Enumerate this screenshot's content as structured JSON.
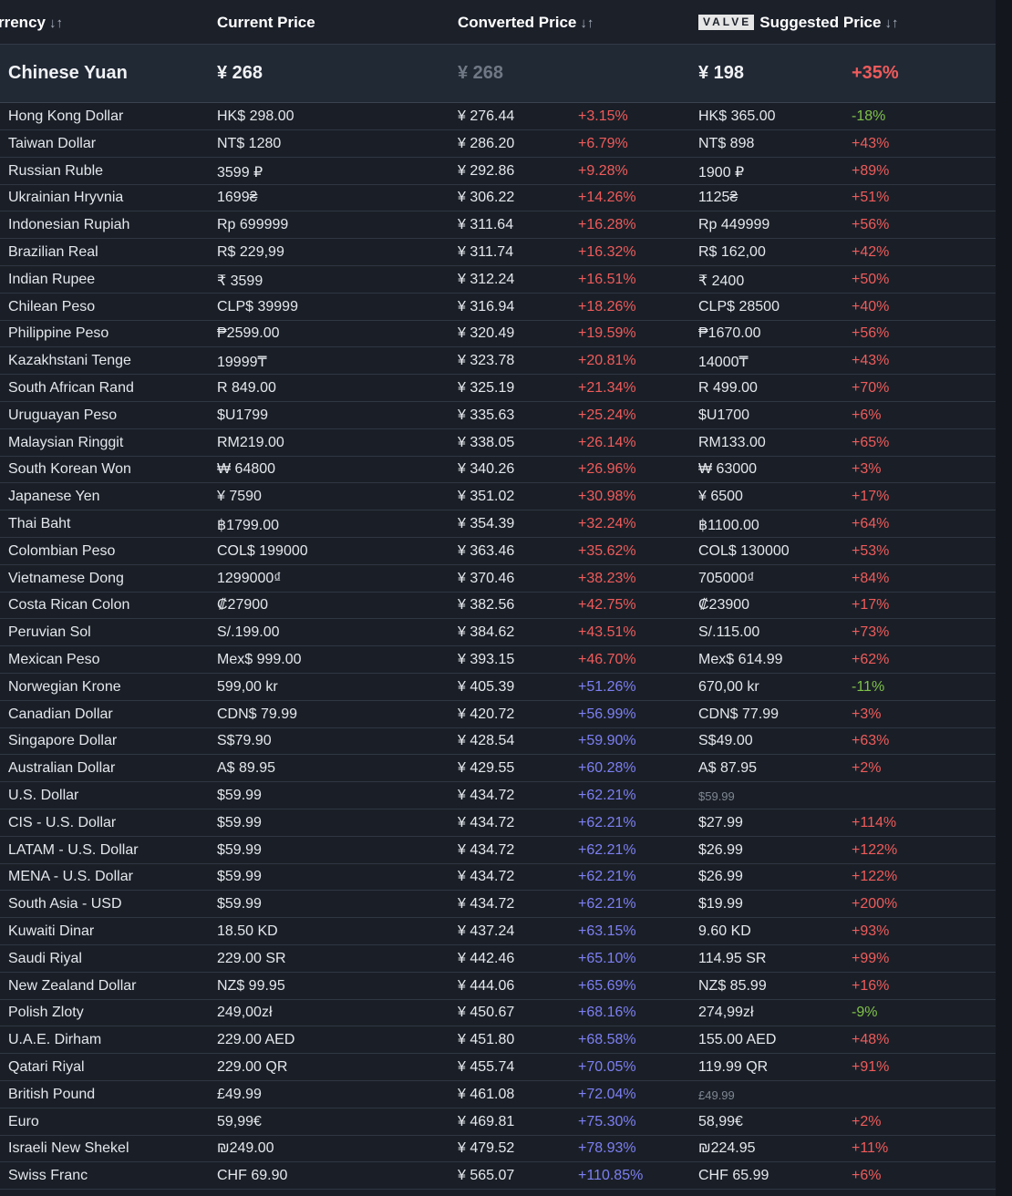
{
  "header": {
    "currency": "rrency",
    "current_price": "Current Price",
    "converted_price": "Converted Price",
    "valve_logo": "VALVE",
    "suggested_price": "Suggested Price",
    "sort_glyph": "↓↑"
  },
  "highlight": {
    "currency": "Chinese Yuan",
    "current_price": "¥ 268",
    "converted_price": "¥ 268",
    "suggested_price": "¥ 198",
    "suggested_diff": "+35%"
  },
  "colors": {
    "positive_red": "#ef5b5b",
    "positive_blue": "#7d7ff2",
    "negative_green": "#7fc14a"
  },
  "rows": [
    {
      "currency": "Hong Kong Dollar",
      "current_price": "HK$ 298.00",
      "converted_price": "¥ 276.44",
      "converted_diff": "+3.15%",
      "suggested_price": "HK$ 365.00",
      "suggested_diff": "-18%"
    },
    {
      "currency": "Taiwan Dollar",
      "current_price": "NT$ 1280",
      "converted_price": "¥ 286.20",
      "converted_diff": "+6.79%",
      "suggested_price": "NT$ 898",
      "suggested_diff": "+43%"
    },
    {
      "currency": "Russian Ruble",
      "current_price": "3599 ₽",
      "converted_price": "¥ 292.86",
      "converted_diff": "+9.28%",
      "suggested_price": "1900 ₽",
      "suggested_diff": "+89%"
    },
    {
      "currency": "Ukrainian Hryvnia",
      "current_price": "1699₴",
      "converted_price": "¥ 306.22",
      "converted_diff": "+14.26%",
      "suggested_price": "1125₴",
      "suggested_diff": "+51%"
    },
    {
      "currency": "Indonesian Rupiah",
      "current_price": "Rp 699999",
      "converted_price": "¥ 311.64",
      "converted_diff": "+16.28%",
      "suggested_price": "Rp 449999",
      "suggested_diff": "+56%"
    },
    {
      "currency": "Brazilian Real",
      "current_price": "R$ 229,99",
      "converted_price": "¥ 311.74",
      "converted_diff": "+16.32%",
      "suggested_price": "R$ 162,00",
      "suggested_diff": "+42%"
    },
    {
      "currency": "Indian Rupee",
      "current_price": "₹ 3599",
      "converted_price": "¥ 312.24",
      "converted_diff": "+16.51%",
      "suggested_price": "₹ 2400",
      "suggested_diff": "+50%"
    },
    {
      "currency": "Chilean Peso",
      "current_price": "CLP$ 39999",
      "converted_price": "¥ 316.94",
      "converted_diff": "+18.26%",
      "suggested_price": "CLP$ 28500",
      "suggested_diff": "+40%"
    },
    {
      "currency": "Philippine Peso",
      "current_price": "₱2599.00",
      "converted_price": "¥ 320.49",
      "converted_diff": "+19.59%",
      "suggested_price": "₱1670.00",
      "suggested_diff": "+56%"
    },
    {
      "currency": "Kazakhstani Tenge",
      "current_price": "19999₸",
      "converted_price": "¥ 323.78",
      "converted_diff": "+20.81%",
      "suggested_price": "14000₸",
      "suggested_diff": "+43%"
    },
    {
      "currency": "South African Rand",
      "current_price": "R 849.00",
      "converted_price": "¥ 325.19",
      "converted_diff": "+21.34%",
      "suggested_price": "R 499.00",
      "suggested_diff": "+70%"
    },
    {
      "currency": "Uruguayan Peso",
      "current_price": "$U1799",
      "converted_price": "¥ 335.63",
      "converted_diff": "+25.24%",
      "suggested_price": "$U1700",
      "suggested_diff": "+6%"
    },
    {
      "currency": "Malaysian Ringgit",
      "current_price": "RM219.00",
      "converted_price": "¥ 338.05",
      "converted_diff": "+26.14%",
      "suggested_price": "RM133.00",
      "suggested_diff": "+65%"
    },
    {
      "currency": "South Korean Won",
      "current_price": "₩ 64800",
      "converted_price": "¥ 340.26",
      "converted_diff": "+26.96%",
      "suggested_price": "₩ 63000",
      "suggested_diff": "+3%"
    },
    {
      "currency": "Japanese Yen",
      "current_price": "¥ 7590",
      "converted_price": "¥ 351.02",
      "converted_diff": "+30.98%",
      "suggested_price": "¥ 6500",
      "suggested_diff": "+17%"
    },
    {
      "currency": "Thai Baht",
      "current_price": "฿1799.00",
      "converted_price": "¥ 354.39",
      "converted_diff": "+32.24%",
      "suggested_price": "฿1100.00",
      "suggested_diff": "+64%"
    },
    {
      "currency": "Colombian Peso",
      "current_price": "COL$ 199000",
      "converted_price": "¥ 363.46",
      "converted_diff": "+35.62%",
      "suggested_price": "COL$ 130000",
      "suggested_diff": "+53%"
    },
    {
      "currency": "Vietnamese Dong",
      "current_price": "1299000₫",
      "converted_price": "¥ 370.46",
      "converted_diff": "+38.23%",
      "suggested_price": "705000₫",
      "suggested_diff": "+84%"
    },
    {
      "currency": "Costa Rican Colon",
      "current_price": "₡27900",
      "converted_price": "¥ 382.56",
      "converted_diff": "+42.75%",
      "suggested_price": "₡23900",
      "suggested_diff": "+17%"
    },
    {
      "currency": "Peruvian Sol",
      "current_price": "S/.199.00",
      "converted_price": "¥ 384.62",
      "converted_diff": "+43.51%",
      "suggested_price": "S/.115.00",
      "suggested_diff": "+73%"
    },
    {
      "currency": "Mexican Peso",
      "current_price": "Mex$ 999.00",
      "converted_price": "¥ 393.15",
      "converted_diff": "+46.70%",
      "suggested_price": "Mex$ 614.99",
      "suggested_diff": "+62%"
    },
    {
      "currency": "Norwegian Krone",
      "current_price": "599,00 kr",
      "converted_price": "¥ 405.39",
      "converted_diff": "+51.26%",
      "suggested_price": "670,00 kr",
      "suggested_diff": "-11%"
    },
    {
      "currency": "Canadian Dollar",
      "current_price": "CDN$ 79.99",
      "converted_price": "¥ 420.72",
      "converted_diff": "+56.99%",
      "suggested_price": "CDN$ 77.99",
      "suggested_diff": "+3%"
    },
    {
      "currency": "Singapore Dollar",
      "current_price": "S$79.90",
      "converted_price": "¥ 428.54",
      "converted_diff": "+59.90%",
      "suggested_price": "S$49.00",
      "suggested_diff": "+63%"
    },
    {
      "currency": "Australian Dollar",
      "current_price": "A$ 89.95",
      "converted_price": "¥ 429.55",
      "converted_diff": "+60.28%",
      "suggested_price": "A$ 87.95",
      "suggested_diff": "+2%"
    },
    {
      "currency": "U.S. Dollar",
      "current_price": "$59.99",
      "converted_price": "¥ 434.72",
      "converted_diff": "+62.21%",
      "suggested_price": "$59.99",
      "suggested_diff": "",
      "dim": true
    },
    {
      "currency": "CIS - U.S. Dollar",
      "current_price": "$59.99",
      "converted_price": "¥ 434.72",
      "converted_diff": "+62.21%",
      "suggested_price": "$27.99",
      "suggested_diff": "+114%"
    },
    {
      "currency": "LATAM - U.S. Dollar",
      "current_price": "$59.99",
      "converted_price": "¥ 434.72",
      "converted_diff": "+62.21%",
      "suggested_price": "$26.99",
      "suggested_diff": "+122%"
    },
    {
      "currency": "MENA - U.S. Dollar",
      "current_price": "$59.99",
      "converted_price": "¥ 434.72",
      "converted_diff": "+62.21%",
      "suggested_price": "$26.99",
      "suggested_diff": "+122%"
    },
    {
      "currency": "South Asia - USD",
      "current_price": "$59.99",
      "converted_price": "¥ 434.72",
      "converted_diff": "+62.21%",
      "suggested_price": "$19.99",
      "suggested_diff": "+200%"
    },
    {
      "currency": "Kuwaiti Dinar",
      "current_price": "18.50 KD",
      "converted_price": "¥ 437.24",
      "converted_diff": "+63.15%",
      "suggested_price": "9.60 KD",
      "suggested_diff": "+93%"
    },
    {
      "currency": "Saudi Riyal",
      "current_price": "229.00 SR",
      "converted_price": "¥ 442.46",
      "converted_diff": "+65.10%",
      "suggested_price": "114.95 SR",
      "suggested_diff": "+99%"
    },
    {
      "currency": "New Zealand Dollar",
      "current_price": "NZ$ 99.95",
      "converted_price": "¥ 444.06",
      "converted_diff": "+65.69%",
      "suggested_price": "NZ$ 85.99",
      "suggested_diff": "+16%"
    },
    {
      "currency": "Polish Zloty",
      "current_price": "249,00zł",
      "converted_price": "¥ 450.67",
      "converted_diff": "+68.16%",
      "suggested_price": "274,99zł",
      "suggested_diff": "-9%"
    },
    {
      "currency": "U.A.E. Dirham",
      "current_price": "229.00 AED",
      "converted_price": "¥ 451.80",
      "converted_diff": "+68.58%",
      "suggested_price": "155.00 AED",
      "suggested_diff": "+48%"
    },
    {
      "currency": "Qatari Riyal",
      "current_price": "229.00 QR",
      "converted_price": "¥ 455.74",
      "converted_diff": "+70.05%",
      "suggested_price": "119.99 QR",
      "suggested_diff": "+91%"
    },
    {
      "currency": "British Pound",
      "current_price": "£49.99",
      "converted_price": "¥ 461.08",
      "converted_diff": "+72.04%",
      "suggested_price": "£49.99",
      "suggested_diff": "",
      "dim": true
    },
    {
      "currency": "Euro",
      "current_price": "59,99€",
      "converted_price": "¥ 469.81",
      "converted_diff": "+75.30%",
      "suggested_price": "58,99€",
      "suggested_diff": "+2%"
    },
    {
      "currency": "Israeli New Shekel",
      "current_price": "₪249.00",
      "converted_price": "¥ 479.52",
      "converted_diff": "+78.93%",
      "suggested_price": "₪224.95",
      "suggested_diff": "+11%"
    },
    {
      "currency": "Swiss Franc",
      "current_price": "CHF 69.90",
      "converted_price": "¥ 565.07",
      "converted_diff": "+110.85%",
      "suggested_price": "CHF 65.99",
      "suggested_diff": "+6%"
    }
  ]
}
